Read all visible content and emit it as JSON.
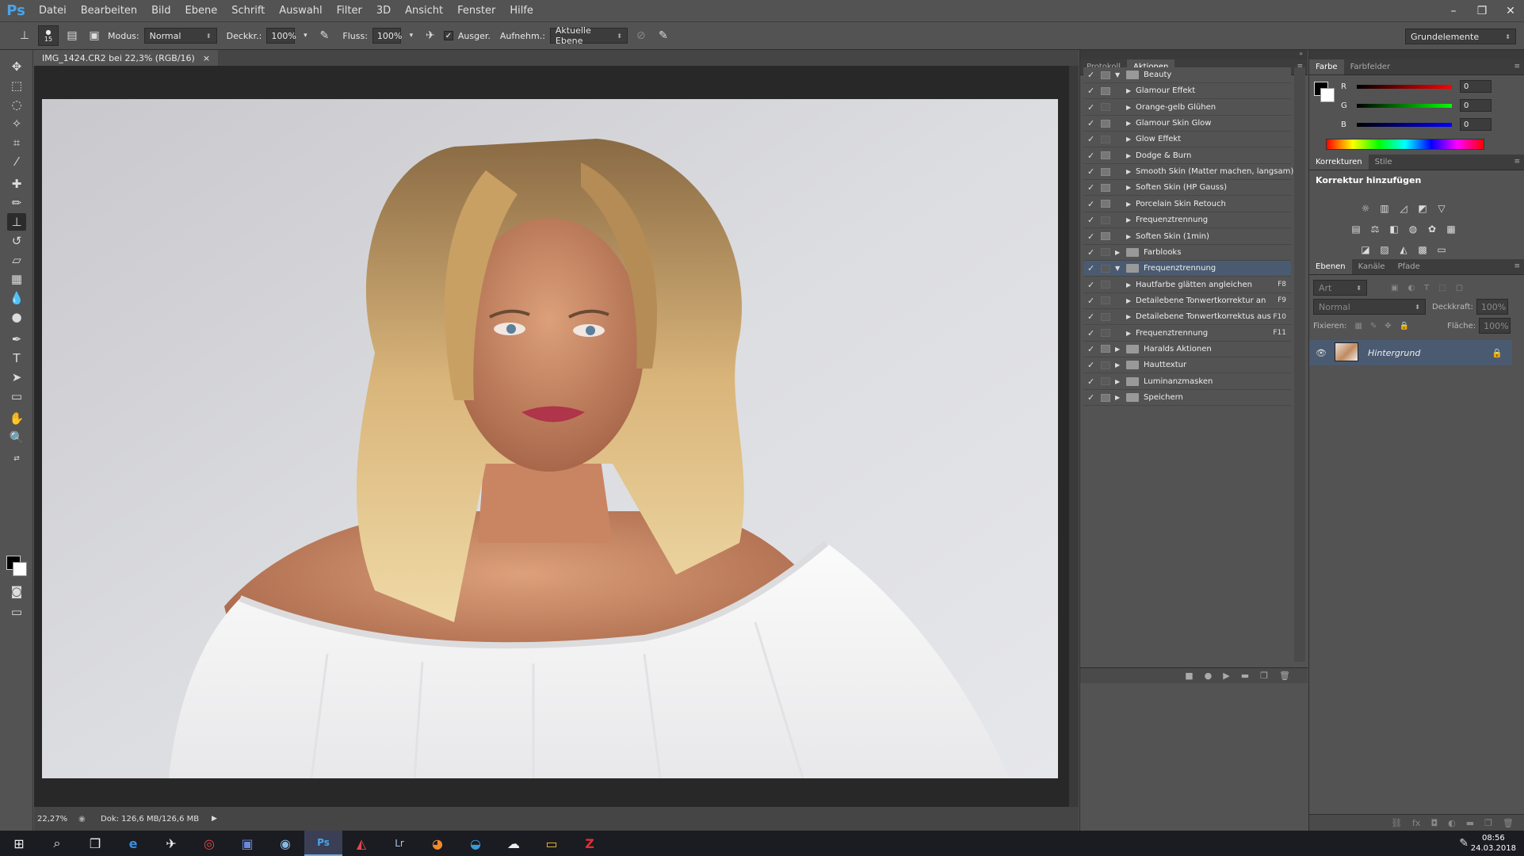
{
  "app": {
    "logo": "Ps"
  },
  "menu": [
    "Datei",
    "Bearbeiten",
    "Bild",
    "Ebene",
    "Schrift",
    "Auswahl",
    "Filter",
    "3D",
    "Ansicht",
    "Fenster",
    "Hilfe"
  ],
  "window_controls": {
    "minimize": "–",
    "restore": "❐",
    "close": "✕"
  },
  "options": {
    "brush_size": "15",
    "modus_label": "Modus:",
    "modus_value": "Normal",
    "deckkr_label": "Deckkr.:",
    "deckkr_value": "100%",
    "fluss_label": "Fluss:",
    "fluss_value": "100%",
    "ausger_label": "Ausger.",
    "aufnehm_label": "Aufnehm.:",
    "aufnehm_value": "Aktuelle Ebene",
    "workspace": "Grundelemente"
  },
  "document": {
    "tab_title": "IMG_1424.CR2 bei 22,3% (RGB/16)",
    "tab_close": "×",
    "zoom": "22,27%",
    "doc_info": "Dok: 126,6 MB/126,6 MB"
  },
  "actions_panel": {
    "tabs": [
      "Protokoll",
      "Aktionen"
    ],
    "rows": [
      {
        "label": "Beauty",
        "type": "set",
        "expanded": true,
        "level": 0,
        "key": ""
      },
      {
        "label": "Glamour Effekt",
        "type": "action",
        "level": 1,
        "key": ""
      },
      {
        "label": "Orange-gelb Glühen",
        "type": "action",
        "level": 1,
        "key": ""
      },
      {
        "label": "Glamour Skin Glow",
        "type": "action",
        "level": 1,
        "key": ""
      },
      {
        "label": "Glow Effekt",
        "type": "action",
        "level": 1,
        "key": ""
      },
      {
        "label": "Dodge & Burn",
        "type": "action",
        "level": 1,
        "key": ""
      },
      {
        "label": "Smooth Skin (Matter machen, langsam)",
        "type": "action",
        "level": 1,
        "key": ""
      },
      {
        "label": "Soften Skin (HP Gauss)",
        "type": "action",
        "level": 1,
        "key": ""
      },
      {
        "label": "Porcelain Skin Retouch",
        "type": "action",
        "level": 1,
        "key": ""
      },
      {
        "label": "Frequenztrennung",
        "type": "action",
        "level": 1,
        "key": ""
      },
      {
        "label": "Soften Skin (1min)",
        "type": "action",
        "level": 1,
        "key": ""
      },
      {
        "label": "Farblooks",
        "type": "set",
        "expanded": false,
        "level": 0,
        "key": ""
      },
      {
        "label": "Frequenztrennung",
        "type": "set",
        "expanded": true,
        "level": 0,
        "key": "",
        "selected": true
      },
      {
        "label": "Hautfarbe glätten angleichen",
        "type": "action",
        "level": 1,
        "key": "F8"
      },
      {
        "label": "Detailebene Tonwertkorrektur an",
        "type": "action",
        "level": 1,
        "key": "F9"
      },
      {
        "label": "Detailebene Tonwertkorrektus aus",
        "type": "action",
        "level": 1,
        "key": "F10"
      },
      {
        "label": "Frequenztrennung",
        "type": "action",
        "level": 1,
        "key": "F11"
      },
      {
        "label": "Haralds Aktionen",
        "type": "set",
        "expanded": false,
        "level": 0,
        "key": ""
      },
      {
        "label": "Hauttextur",
        "type": "set",
        "expanded": false,
        "level": 0,
        "key": ""
      },
      {
        "label": "Luminanzmasken",
        "type": "set",
        "expanded": false,
        "level": 0,
        "key": ""
      },
      {
        "label": "Speichern",
        "type": "set",
        "expanded": false,
        "level": 0,
        "key": ""
      }
    ],
    "dialog_on": [
      true,
      true,
      false,
      true,
      false,
      true,
      true,
      true,
      true,
      false,
      true,
      false,
      false,
      false,
      false,
      false,
      false,
      true,
      false,
      false,
      true
    ]
  },
  "color_panel": {
    "tabs": [
      "Farbe",
      "Farbfelder"
    ],
    "sliders": [
      {
        "label": "R",
        "value": "0",
        "gradient": "linear-gradient(to right,#000,#ff0000)"
      },
      {
        "label": "G",
        "value": "0",
        "gradient": "linear-gradient(to right,#000,#00ff00)"
      },
      {
        "label": "B",
        "value": "0",
        "gradient": "linear-gradient(to right,#000,#0000ff)"
      }
    ]
  },
  "adjustments_panel": {
    "tabs": [
      "Korrekturen",
      "Stile"
    ],
    "title": "Korrektur hinzufügen"
  },
  "layers_panel": {
    "tabs": [
      "Ebenen",
      "Kanäle",
      "Pfade"
    ],
    "filter_label": "Art",
    "blend_mode": "Normal",
    "opacity_label": "Deckkraft:",
    "opacity_value": "100%",
    "lock_label": "Fixieren:",
    "fill_label": "Fläche:",
    "fill_value": "100%",
    "layers": [
      {
        "name": "Hintergrund"
      }
    ]
  },
  "taskbar": {
    "time": "08:56",
    "date": "24.03.2018"
  }
}
